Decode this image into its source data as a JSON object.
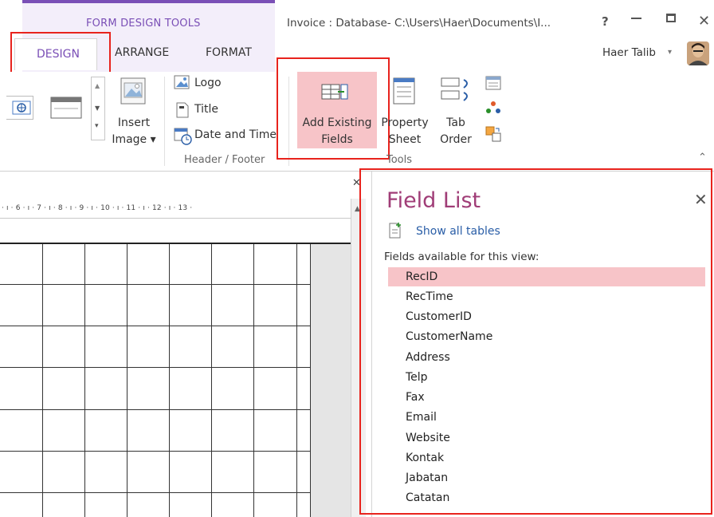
{
  "header": {
    "context_label": "FORM DESIGN TOOLS",
    "window_title": "Invoice : Database- C:\\Users\\Haer\\Documents\\I...",
    "help": "?",
    "close": "✕",
    "user_name": "Haer Talib",
    "user_caret": "▾"
  },
  "tabs": [
    {
      "label": "DESIGN"
    },
    {
      "label": "ARRANGE"
    },
    {
      "label": "FORMAT"
    }
  ],
  "ribbon": {
    "insert_image": "Insert\nImage",
    "insert_image_line1": "Insert",
    "insert_image_line2": "Image ▾",
    "logo": "Logo",
    "title": "Title",
    "date_time": "Date and Time",
    "header_footer_label": "Header / Footer",
    "add_existing_fields_line1": "Add Existing",
    "add_existing_fields_line2": "Fields",
    "property_sheet_line1": "Property",
    "property_sheet_line2": "Sheet",
    "tab_order_line1": "Tab",
    "tab_order_line2": "Order",
    "tools_label": "Tools",
    "collapse": "⌃"
  },
  "designer": {
    "close": "✕",
    "ruler_text": "· ı · 6 · ı · 7 · ı · 8 · ı · 9 · ı · 10 · ı · 11 · ı · 12 · ı · 13 ·"
  },
  "field_list": {
    "title": "Field List",
    "close": "✕",
    "show_all_tables": "Show all tables",
    "fields_available": "Fields available for this view:",
    "fields": [
      "RecID",
      "RecTime",
      "CustomerID",
      "CustomerName",
      "Address",
      "Telp",
      "Fax",
      "Email",
      "Website",
      "Kontak",
      "Jabatan",
      "Catatan"
    ],
    "selected": "RecID"
  },
  "colors": {
    "accent_purple": "#7a4fb6",
    "access_maroon": "#a03d77",
    "highlight_red": "#e8231d",
    "selected_row": "#f7c4c8"
  }
}
